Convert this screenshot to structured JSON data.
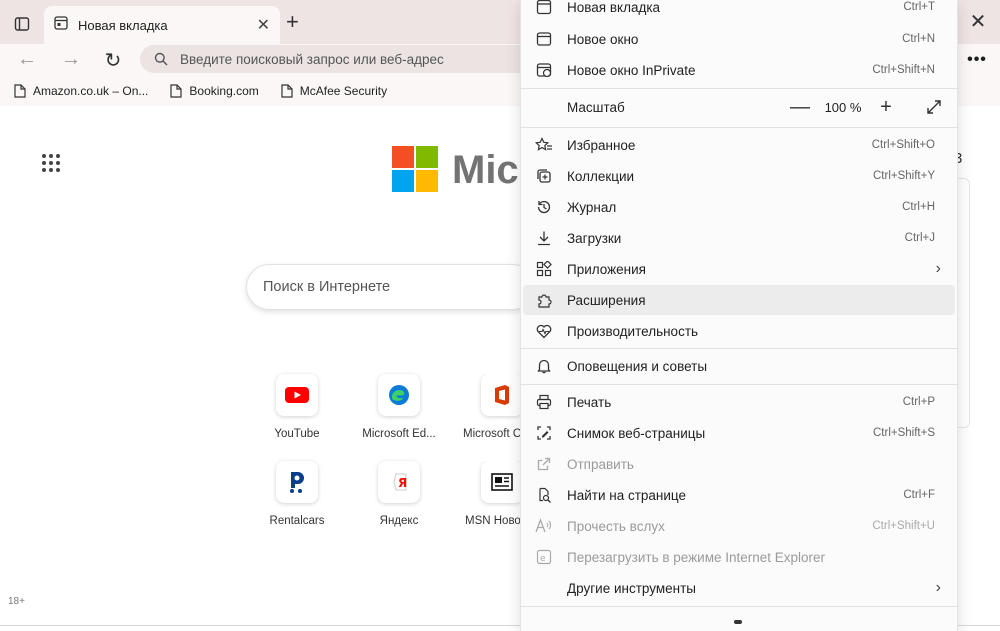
{
  "tab": {
    "title": "Новая вкладка",
    "close_glyph": "✕"
  },
  "newtab_glyph": "+",
  "window": {
    "close_glyph": "✕"
  },
  "toolbar": {
    "back_glyph": "←",
    "forward_glyph": "→",
    "refresh_glyph": "↻",
    "address_placeholder": "Введите поисковый запрос или веб-адрес",
    "more_glyph": "•••"
  },
  "favorites": [
    {
      "label": "Amazon.co.uk – On..."
    },
    {
      "label": "Booking.com"
    },
    {
      "label": "McAfee Security"
    }
  ],
  "content": {
    "brand_text": "Micr",
    "search_placeholder": "Поиск в Интернете",
    "age_label": "18+",
    "panel_number": "3",
    "logo_colors": [
      "#f25022",
      "#7fba00",
      "#00a4ef",
      "#ffb900"
    ],
    "tiles": [
      {
        "name": "YouTube",
        "icon": "youtube-icon"
      },
      {
        "name": "Microsoft Ed...",
        "icon": "edge-icon"
      },
      {
        "name": "Microsoft O",
        "icon": "office-icon"
      },
      {
        "name": "Rentalcars",
        "icon": "rentalcars-icon"
      },
      {
        "name": "Яндекс",
        "icon": "yandex-icon"
      },
      {
        "name": "MSN Ново",
        "icon": "msn-icon"
      }
    ]
  },
  "menu": {
    "items": [
      {
        "id": "new-tab",
        "label": "Новая вкладка",
        "shortcut": "Ctrl+T",
        "icon": "new-tab-icon"
      },
      {
        "id": "new-window",
        "label": "Новое окно",
        "shortcut": "Ctrl+N",
        "icon": "new-window-icon"
      },
      {
        "id": "inprivate",
        "label": "Новое окно InPrivate",
        "shortcut": "Ctrl+Shift+N",
        "icon": "inprivate-icon"
      },
      {
        "id": "favorites",
        "label": "Избранное",
        "shortcut": "Ctrl+Shift+O",
        "icon": "favorites-icon"
      },
      {
        "id": "collections",
        "label": "Коллекции",
        "shortcut": "Ctrl+Shift+Y",
        "icon": "collections-icon"
      },
      {
        "id": "history",
        "label": "Журнал",
        "shortcut": "Ctrl+H",
        "icon": "history-icon"
      },
      {
        "id": "downloads",
        "label": "Загрузки",
        "shortcut": "Ctrl+J",
        "icon": "downloads-icon"
      },
      {
        "id": "apps",
        "label": "Приложения",
        "shortcut": "",
        "icon": "apps-icon",
        "submenu": true
      },
      {
        "id": "extensions",
        "label": "Расширения",
        "shortcut": "",
        "icon": "extensions-icon"
      },
      {
        "id": "performance",
        "label": "Производительность",
        "shortcut": "",
        "icon": "performance-icon"
      },
      {
        "id": "notifications",
        "label": "Оповещения и советы",
        "shortcut": "",
        "icon": "notifications-icon"
      },
      {
        "id": "print",
        "label": "Печать",
        "shortcut": "Ctrl+P",
        "icon": "print-icon"
      },
      {
        "id": "screenshot",
        "label": "Снимок веб-страницы",
        "shortcut": "Ctrl+Shift+S",
        "icon": "screenshot-icon"
      },
      {
        "id": "share",
        "label": "Отправить",
        "shortcut": "",
        "icon": "share-icon",
        "disabled": true
      },
      {
        "id": "find",
        "label": "Найти на странице",
        "shortcut": "Ctrl+F",
        "icon": "find-icon"
      },
      {
        "id": "read-aloud",
        "label": "Прочесть вслух",
        "shortcut": "Ctrl+Shift+U",
        "icon": "read-aloud-icon",
        "disabled": true
      },
      {
        "id": "ie-mode",
        "label": "Перезагрузить в режиме Internet Explorer",
        "shortcut": "",
        "icon": "ie-mode-icon",
        "disabled": true
      },
      {
        "id": "more-tools",
        "label": "Другие инструменты",
        "shortcut": "",
        "icon": "more-tools-icon",
        "submenu": true
      }
    ],
    "zoom": {
      "label": "Масштаб",
      "value": "100 %",
      "minus": "—",
      "plus": "+"
    },
    "submenu_chevron": "›"
  }
}
